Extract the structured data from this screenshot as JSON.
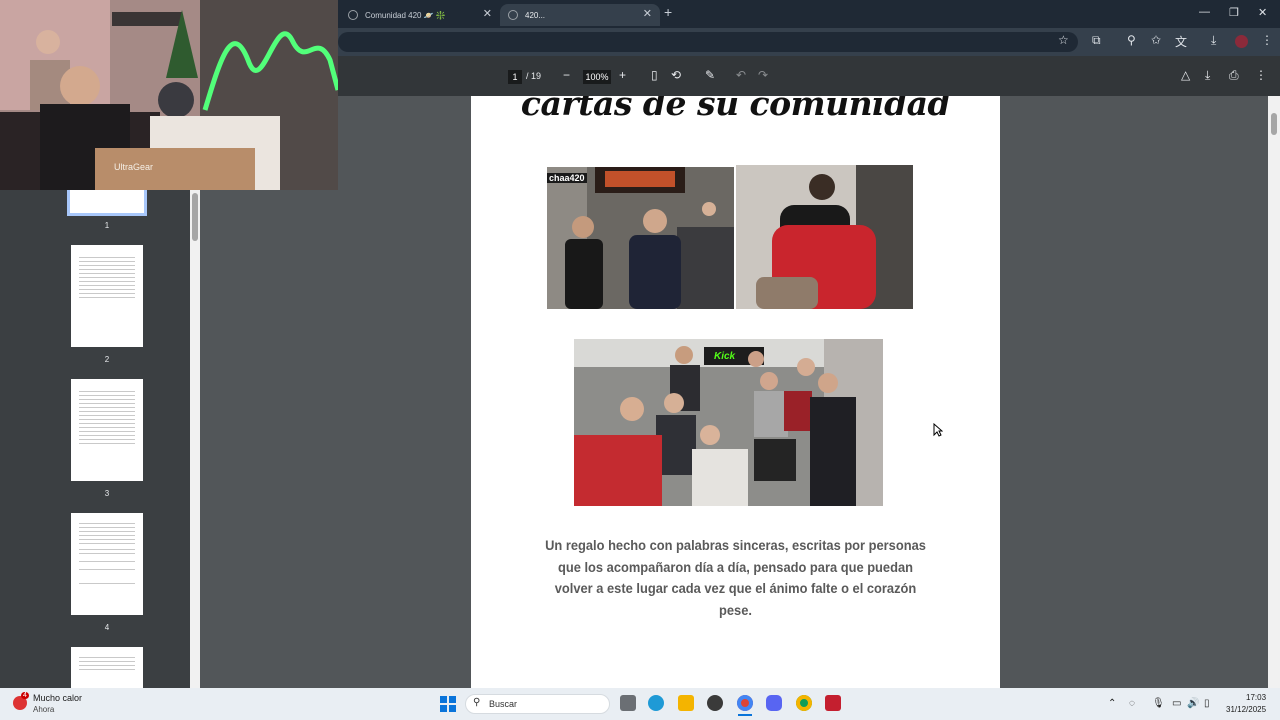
{
  "browser": {
    "tabs": [
      {
        "title": "Comunidad 420 🪐 ❇️",
        "active": false
      },
      {
        "title": "420...",
        "active": true
      }
    ]
  },
  "pdf_viewer": {
    "current_page": "1",
    "total_pages": "/ 19",
    "zoom": "100%"
  },
  "thumbnails": [
    {
      "label": "1"
    },
    {
      "label": "2"
    },
    {
      "label": "3"
    },
    {
      "label": "4"
    }
  ],
  "document": {
    "heading": "cartas de su comunidad",
    "photo_overlay_text": "chaa420",
    "banner_text": "Kick",
    "caption": "Un regalo hecho con palabras sinceras, escritas por personas que los acompañaron día a día, pensado para que puedan volver a este lugar cada vez que el ánimo falte o el corazón pese."
  },
  "webcam": {
    "box_brand": "UltraGear"
  },
  "taskbar": {
    "weather_title": "Mucho calor",
    "weather_subtitle": "Ahora",
    "weather_badge": "4",
    "search_placeholder": "Buscar",
    "time": "17:03",
    "date": "31/12/2025"
  },
  "colors": {
    "title_bar": "#1f2935",
    "pdf_toolbar": "#323639",
    "pdf_background": "#525659",
    "sidebar": "#3b3f42"
  }
}
